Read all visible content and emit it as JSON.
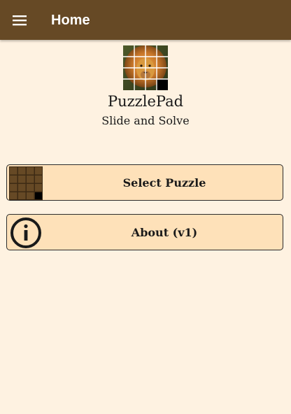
{
  "appbar": {
    "title": "Home",
    "menu_icon": "hamburger-menu-icon",
    "background": "#664925"
  },
  "header": {
    "app_name": "PuzzlePad",
    "tagline": "Slide and Solve",
    "logo": "lion-puzzle-logo"
  },
  "menu": {
    "select_puzzle": {
      "label": "Select Puzzle",
      "icon": "puzzle-grid-icon"
    },
    "about": {
      "label": "About (v1)",
      "icon": "info-icon"
    }
  },
  "colors": {
    "background": "#fef2e1",
    "card": "#fee1b9",
    "text": "#1a1a1a"
  }
}
